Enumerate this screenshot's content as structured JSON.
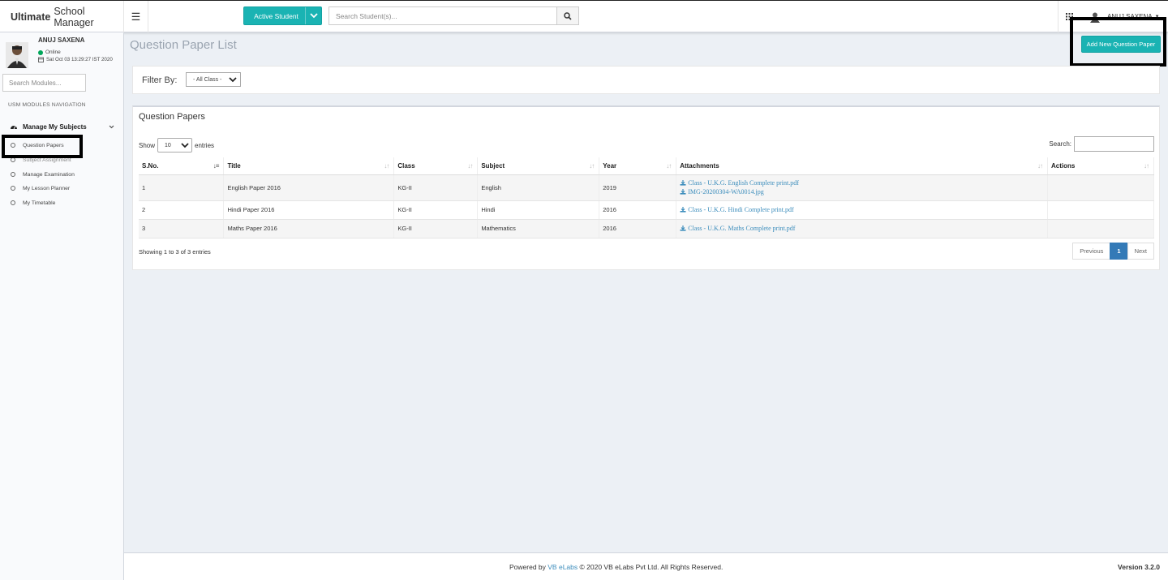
{
  "header": {
    "logo_bold": "Ultimate",
    "logo_rest": "School Manager",
    "student_dropdown": "Active Student",
    "search_placeholder": "Search Student(s)...",
    "user_name": "ANUJ SAXENA"
  },
  "sidebar": {
    "user_name": "ANUJ SAXENA",
    "status": "Online",
    "datetime": "Sat Oct 03 13:29:27 IST 2020",
    "search_placeholder": "Search Modules...",
    "nav_header": "USM MODULES NAVIGATION",
    "group_label": "Manage My Subjects",
    "items": [
      {
        "label": "Question Papers"
      },
      {
        "label": "Subject Assignment"
      },
      {
        "label": "Manage Examination"
      },
      {
        "label": "My Lesson Planner"
      },
      {
        "label": "My Timetable"
      }
    ]
  },
  "main": {
    "page_title": "Question Paper List",
    "add_button": "Add New Question Paper",
    "filter_label": "Filter By:",
    "class_filter": "- All Class -",
    "panel_title": "Question Papers",
    "show_label": "Show",
    "entries_value": "10",
    "entries_label": "entries",
    "search_label": "Search:",
    "columns": [
      "S.No.",
      "Title",
      "Class",
      "Subject",
      "Year",
      "Attachments",
      "Actions"
    ],
    "rows": [
      {
        "sno": "1",
        "title": "English Paper 2016",
        "class": "KG-II",
        "subject": "English",
        "year": "2019",
        "attachments": [
          "Class - U.K.G. English Complete print.pdf",
          "IMG-20200304-WA0014.jpg"
        ]
      },
      {
        "sno": "2",
        "title": "Hindi Paper 2016",
        "class": "KG-II",
        "subject": "Hindi",
        "year": "2016",
        "attachments": [
          "Class - U.K.G. Hindi Complete print.pdf"
        ]
      },
      {
        "sno": "3",
        "title": "Maths Paper 2016",
        "class": "KG-II",
        "subject": "Mathematics",
        "year": "2016",
        "attachments": [
          "Class - U.K.G. Maths Complete print.pdf"
        ]
      }
    ],
    "info": "Showing 1 to 3 of 3 entries",
    "pagination": {
      "previous": "Previous",
      "current": "1",
      "next": "Next"
    }
  },
  "footer": {
    "powered_by": "Powered by",
    "company": "VB eLabs",
    "copyright": "© 2020 VB eLabs Pvt Ltd. All Rights Reserved.",
    "version": "Version 3.2.0"
  },
  "colors": {
    "accent": "#1ab3b3",
    "link": "#3c8dbc",
    "online": "#00a65a",
    "page_bg": "#ecf0f5"
  }
}
